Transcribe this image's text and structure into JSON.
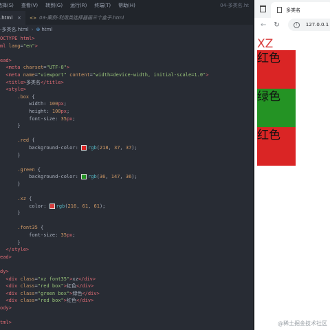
{
  "editor": {
    "menu": [
      "选择(S)",
      "查看(V)",
      "转到(G)",
      "运行(R)",
      "终端(T)",
      "帮助(H)"
    ],
    "window_title": "04-多类名.ht",
    "tabs": [
      {
        "label": ".html",
        "close": "×"
      },
      {
        "label": "03-案例-利用类选择器画三个盒子.html"
      }
    ],
    "breadcrumb": [
      "-多类名.html",
      "html"
    ],
    "code": [
      [
        [
          "OCTYPE html>",
          "tg"
        ]
      ],
      [
        [
          "ml ",
          "tg"
        ],
        [
          "lang",
          "at"
        ],
        [
          "=",
          "pu"
        ],
        [
          "\"en\"",
          "st"
        ],
        [
          ">",
          "tg"
        ]
      ],
      [],
      [
        [
          "ead>",
          "tg"
        ]
      ],
      [
        [
          "  <meta ",
          "tg"
        ],
        [
          "charset",
          "at"
        ],
        [
          "=",
          "pu"
        ],
        [
          "\"UTF-8\"",
          "st"
        ],
        [
          ">",
          "tg"
        ]
      ],
      [
        [
          "  <meta ",
          "tg"
        ],
        [
          "name",
          "at"
        ],
        [
          "=",
          "pu"
        ],
        [
          "\"viewport\"",
          "st"
        ],
        [
          " content",
          "at"
        ],
        [
          "=",
          "pu"
        ],
        [
          "\"width=device-width, initial-scale=1.0\"",
          "st"
        ],
        [
          ">",
          "tg"
        ]
      ],
      [
        [
          "  <title>",
          "tg"
        ],
        [
          "多类名",
          "pu"
        ],
        [
          "</title>",
          "tg"
        ]
      ],
      [
        [
          "  <style>",
          "tg"
        ]
      ],
      [
        [
          "      .box ",
          "sel"
        ],
        [
          "{",
          "pu"
        ]
      ],
      [
        [
          "          width",
          "pr"
        ],
        [
          ": ",
          "pu"
        ],
        [
          "100",
          "nm"
        ],
        [
          "px",
          "un"
        ],
        [
          ";",
          "pu"
        ]
      ],
      [
        [
          "          height",
          "pr"
        ],
        [
          ": ",
          "pu"
        ],
        [
          "100",
          "nm"
        ],
        [
          "px",
          "un"
        ],
        [
          ";",
          "pu"
        ]
      ],
      [
        [
          "          font-size",
          "pr"
        ],
        [
          ": ",
          "pu"
        ],
        [
          "35",
          "nm"
        ],
        [
          "px",
          "un"
        ],
        [
          ";",
          "pu"
        ]
      ],
      [
        [
          "      }",
          "pu"
        ]
      ],
      [],
      [
        [
          "      .red ",
          "sel"
        ],
        [
          "{",
          "pu"
        ]
      ],
      [
        [
          "          background-color",
          "pr"
        ],
        [
          ": ",
          "pu"
        ],
        [
          "SW:#da2525",
          "sw"
        ],
        [
          "rgb",
          "fn"
        ],
        [
          "(",
          "pu"
        ],
        [
          "218",
          "nm"
        ],
        [
          ", ",
          "pu"
        ],
        [
          "37",
          "nm"
        ],
        [
          ", ",
          "pu"
        ],
        [
          "37",
          "nm"
        ],
        [
          ");",
          "pu"
        ]
      ],
      [
        [
          "      }",
          "pu"
        ]
      ],
      [],
      [
        [
          "      .green ",
          "sel"
        ],
        [
          "{",
          "pu"
        ]
      ],
      [
        [
          "          background-color",
          "pr"
        ],
        [
          ": ",
          "pu"
        ],
        [
          "SW:#249324",
          "sw"
        ],
        [
          "rgb",
          "fn"
        ],
        [
          "(",
          "pu"
        ],
        [
          "36",
          "nm"
        ],
        [
          ", ",
          "pu"
        ],
        [
          "147",
          "nm"
        ],
        [
          ", ",
          "pu"
        ],
        [
          "36",
          "nm"
        ],
        [
          ");",
          "pu"
        ]
      ],
      [
        [
          "      }",
          "pu"
        ]
      ],
      [],
      [
        [
          "      .xz ",
          "sel"
        ],
        [
          "{",
          "pu"
        ]
      ],
      [
        [
          "          color",
          "pr"
        ],
        [
          ": ",
          "pu"
        ],
        [
          "SW:#d83d3d",
          "sw"
        ],
        [
          "rgb",
          "fn"
        ],
        [
          "(",
          "pu"
        ],
        [
          "216",
          "nm"
        ],
        [
          ", ",
          "pu"
        ],
        [
          "61",
          "nm"
        ],
        [
          ", ",
          "pu"
        ],
        [
          "61",
          "nm"
        ],
        [
          ");",
          "pu"
        ]
      ],
      [
        [
          "      }",
          "pu"
        ]
      ],
      [],
      [
        [
          "      .font35 ",
          "sel"
        ],
        [
          "{",
          "pu"
        ]
      ],
      [
        [
          "          font-size",
          "pr"
        ],
        [
          ": ",
          "pu"
        ],
        [
          "35",
          "nm"
        ],
        [
          "px",
          "un"
        ],
        [
          ";",
          "pu"
        ]
      ],
      [
        [
          "      }",
          "pu"
        ]
      ],
      [
        [
          "  </style>",
          "tg"
        ]
      ],
      [
        [
          "ead>",
          "tg"
        ]
      ],
      [],
      [
        [
          "dy>",
          "tg"
        ]
      ],
      [
        [
          "  <div ",
          "tg"
        ],
        [
          "class",
          "at"
        ],
        [
          "=",
          "pu"
        ],
        [
          "\"xz font35\"",
          "st"
        ],
        [
          ">",
          "tg"
        ],
        [
          "xz",
          "pu"
        ],
        [
          "</div>",
          "tg"
        ]
      ],
      [
        [
          "  <div ",
          "tg"
        ],
        [
          "class",
          "at"
        ],
        [
          "=",
          "pu"
        ],
        [
          "\"red box\"",
          "st"
        ],
        [
          ">",
          "tg"
        ],
        [
          "红色",
          "pu"
        ],
        [
          "</div>",
          "tg"
        ]
      ],
      [
        [
          "  <div ",
          "tg"
        ],
        [
          "class",
          "at"
        ],
        [
          "=",
          "pu"
        ],
        [
          "\"green box\"",
          "st"
        ],
        [
          ">",
          "tg"
        ],
        [
          "绿色",
          "pu"
        ],
        [
          "</div>",
          "tg"
        ]
      ],
      [
        [
          "  <div ",
          "tg"
        ],
        [
          "class",
          "at"
        ],
        [
          "=",
          "pu"
        ],
        [
          "\"red box\"",
          "st"
        ],
        [
          ">",
          "tg"
        ],
        [
          "红色",
          "pu"
        ],
        [
          "</div>",
          "tg"
        ]
      ],
      [
        [
          "ody>",
          "tg"
        ]
      ],
      [],
      [
        [
          "tml>",
          "tg"
        ]
      ]
    ]
  },
  "browser": {
    "tab_title": "多类名",
    "url": "127.0.0.1",
    "back_icon": "arrow-left-icon",
    "reload_icon": "reload-icon",
    "info_icon": "info-icon",
    "page": {
      "xz_text": "XZ",
      "boxes": [
        {
          "text": "红色",
          "color": "#da2525"
        },
        {
          "text": "绿色",
          "color": "#249324"
        },
        {
          "text": "红色",
          "color": "#da2525"
        }
      ]
    }
  },
  "watermark": "@稀土掘金技术社区"
}
